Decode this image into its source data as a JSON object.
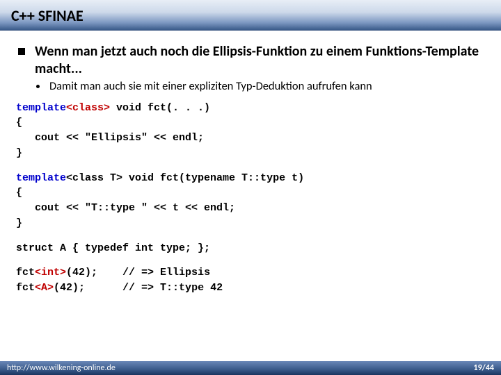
{
  "title": "C++ SFINAE",
  "bullet_main": "Wenn man jetzt auch noch die Ellipsis-Funktion zu einem Funktions-Template macht...",
  "bullet_sub": "Damit man auch sie mit einer expliziten Typ-Deduktion aufrufen kann",
  "code1": {
    "l1a": "template",
    "l1b": "<class>",
    "l1c": " void fct(. . .)",
    "l2": "{",
    "l3": "   cout << \"Ellipsis\" << endl;",
    "l4": "}"
  },
  "code2": {
    "l1a": "template",
    "l1b": "<class T> void fct(typename T::type t)",
    "l2": "{",
    "l3": "   cout << \"T::type \" << t << endl;",
    "l4": "}"
  },
  "code3": "struct A { typedef int type; };",
  "code4": {
    "l1a": "fct",
    "l1b": "<int>",
    "l1c": "(42);    // => Ellipsis",
    "l2a": "fct",
    "l2b": "<A>",
    "l2c": "(42);      // => T::type 42"
  },
  "footer_left": "http://www.wilkening-online.de",
  "footer_right": "19/44"
}
